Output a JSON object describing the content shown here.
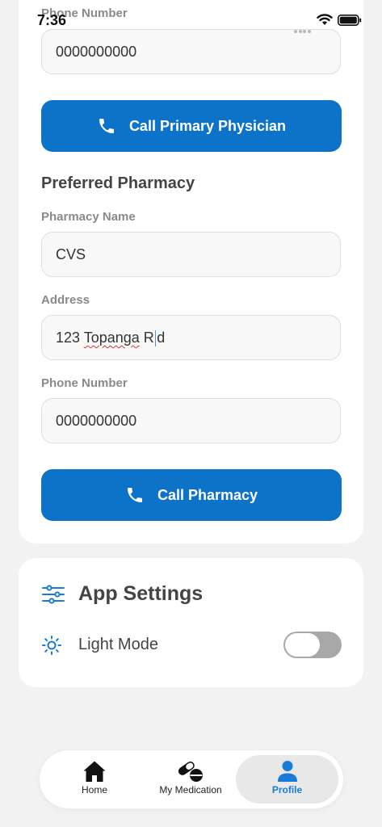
{
  "status_bar": {
    "time": "7:36"
  },
  "physician": {
    "phone_label": "Phone Number",
    "phone_value": "0000000000",
    "call_label": "Call Primary Physician"
  },
  "pharmacy": {
    "section_title": "Preferred Pharmacy",
    "name_label": "Pharmacy Name",
    "name_value": "CVS",
    "address_label": "Address",
    "address_value_a": "123 ",
    "address_value_b": "Topanga",
    "address_value_c": " R",
    "address_value_d": "d",
    "phone_label": "Phone Number",
    "phone_value": "0000000000",
    "call_label": "Call Pharmacy"
  },
  "settings": {
    "title": "App Settings",
    "light_mode_label": "Light Mode",
    "light_mode_on": false
  },
  "tabs": [
    {
      "label": "Home"
    },
    {
      "label": "My Medication"
    },
    {
      "label": "Profile"
    }
  ],
  "colors": {
    "accent": "#0d73c9",
    "active_tab": "#1a7bd6",
    "background": "#f2f2f3"
  }
}
